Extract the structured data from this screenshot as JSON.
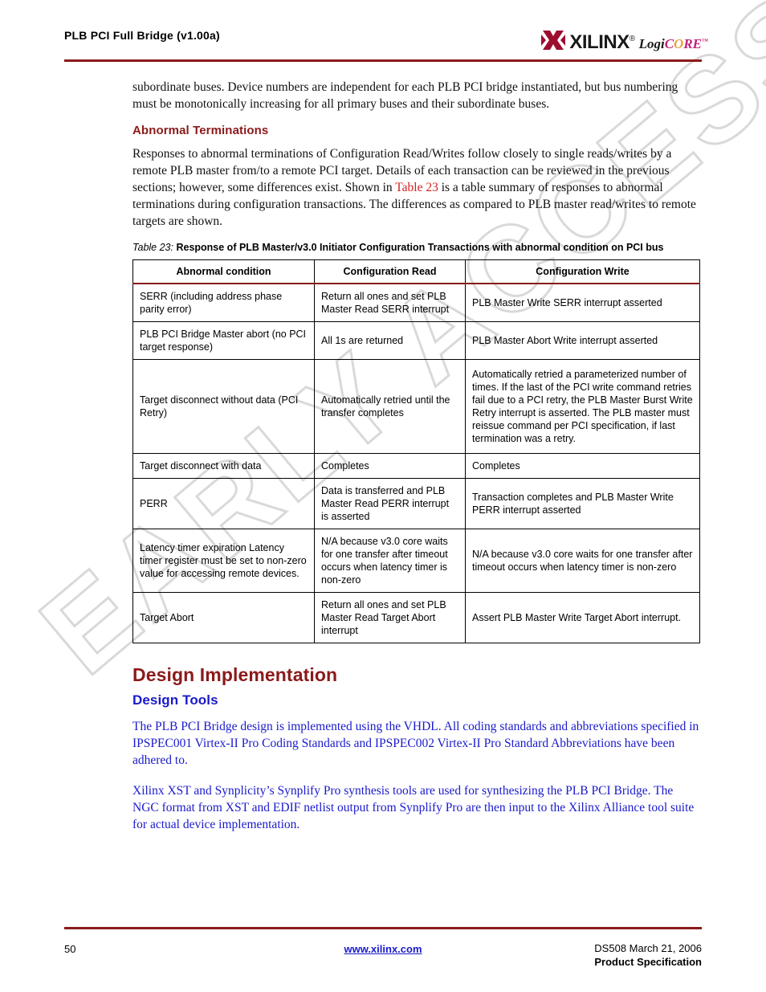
{
  "header": {
    "title": "PLB PCI Full Bridge (v1.00a)",
    "logo_word": "XILINX",
    "logo_reg": "®",
    "logo_core_logi": "Logi",
    "logo_core_c": "C",
    "logo_core_o": "O",
    "logo_core_re": "RE",
    "logo_core_tm": "™",
    "rule_color": "#8b1a1a"
  },
  "watermark": {
    "text": "EARLY ACCESS"
  },
  "body": {
    "intro_paragraph": "subordinate buses. Device numbers are independent for each PLB PCI bridge instantiated, but bus numbering must be monotonically increasing for all primary buses and their subordinate buses.",
    "abnormal_heading": "Abnormal Terminations",
    "abnormal_para_part1": "Responses to abnormal terminations of Configuration Read/Writes follow closely to single reads/writes by a remote PLB master from/to a remote PCI target. Details of each transaction can be reviewed in the previous sections; however, some differences exist. Shown in ",
    "abnormal_xref": "Table 23",
    "abnormal_para_part2": " is a table summary of responses to abnormal terminations during configuration transactions. The differences as compared to PLB master read/writes to remote targets are shown."
  },
  "table": {
    "caption_label": "Table  23:",
    "caption_text": "Response of PLB Master/v3.0 Initiator Configuration Transactions with abnormal condition on PCI bus",
    "columns": [
      "Abnormal condition",
      "Configuration Read",
      "Configuration Write"
    ],
    "rows": [
      {
        "condition": "SERR (including address phase parity error)",
        "read": "Return all ones and set PLB Master Read SERR interrupt",
        "write": "PLB Master Write SERR interrupt asserted"
      },
      {
        "condition": "PLB PCI Bridge Master abort (no PCI target response)",
        "read": "All 1s are returned",
        "write": "PLB Master Abort Write interrupt asserted"
      },
      {
        "condition": "Target disconnect without data (PCI Retry)",
        "read": "Automatically retried until the transfer completes",
        "write": "Automatically retried a parameterized number of times. If the last of the PCI write command retries fail due to a PCI retry, the PLB Master Burst Write Retry interrupt is asserted. The PLB master must reissue command per PCI specification, if last termination was a retry."
      },
      {
        "condition": "Target disconnect with data",
        "read": "Completes",
        "write": "Completes"
      },
      {
        "condition": "PERR",
        "read": "Data is transferred and PLB Master Read PERR interrupt is asserted",
        "write": "Transaction completes and PLB Master Write PERR interrupt asserted"
      },
      {
        "condition": "Latency timer expiration Latency timer register must be set to non-zero value for accessing remote devices.",
        "read": "N/A because v3.0 core waits for one transfer after timeout occurs when latency timer is non-zero",
        "write": "N/A because v3.0 core waits for one transfer after timeout occurs when latency timer is non-zero"
      },
      {
        "condition": "Target Abort",
        "read": "Return all ones and set PLB Master Read Target Abort interrupt",
        "write": "Assert PLB Master Write Target Abort interrupt."
      }
    ]
  },
  "design": {
    "section_heading": "Design Implementation",
    "tools_heading": "Design Tools",
    "tools_para1": "The PLB PCI Bridge design is implemented using the VHDL. All coding standards and abbreviations specified in IPSPEC001 Virtex-II Pro Coding Standards and IPSPEC002 Virtex-II Pro Standard Abbreviations have been adhered to.",
    "tools_para2": "Xilinx XST and Synplicity’s Synplify Pro synthesis tools are used for synthesizing the PLB PCI Bridge. The NGC format from XST and EDIF netlist output from Synplify Pro are then input to the Xilinx Alliance tool suite for actual device implementation."
  },
  "footer": {
    "page_number": "50",
    "link": "www.xilinx.com",
    "doc_id": "DS508 March 21, 2006",
    "doc_type": "Product Specification"
  }
}
